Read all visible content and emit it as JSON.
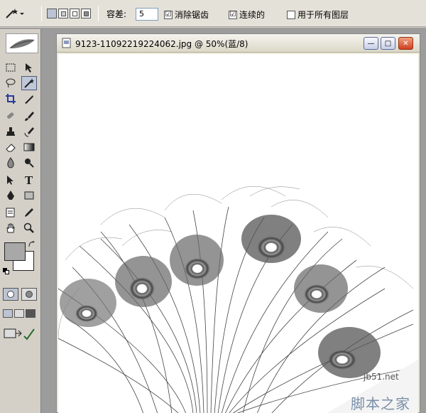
{
  "options_bar": {
    "tolerance_label": "容差:",
    "tolerance_value": "5",
    "anti_alias_label": "消除锯齿",
    "anti_alias_checked": "☑",
    "contiguous_label": "连续的",
    "contiguous_checked": "☑",
    "all_layers_label": "用于所有图层",
    "all_layers_checked": ""
  },
  "toolbox": {
    "tools": [
      "marquee",
      "move",
      "lasso",
      "magic-wand",
      "crop",
      "slice",
      "healing-brush",
      "brush",
      "clone-stamp",
      "history-brush",
      "eraser",
      "gradient",
      "blur",
      "dodge",
      "path-selection",
      "type",
      "pen",
      "shape",
      "notes",
      "eyedropper",
      "hand",
      "zoom"
    ]
  },
  "document": {
    "title": "9123-11092219224062.jpg @ 50%(蓝/8)",
    "minimize_glyph": "—",
    "maximize_glyph": "□",
    "close_glyph": "✕"
  },
  "watermark": {
    "site": "jb51.net",
    "name": "脚本之家"
  },
  "colors": {
    "foreground": "#a8a8a8",
    "background": "#ffffff",
    "accent": "#4a5a7a"
  }
}
